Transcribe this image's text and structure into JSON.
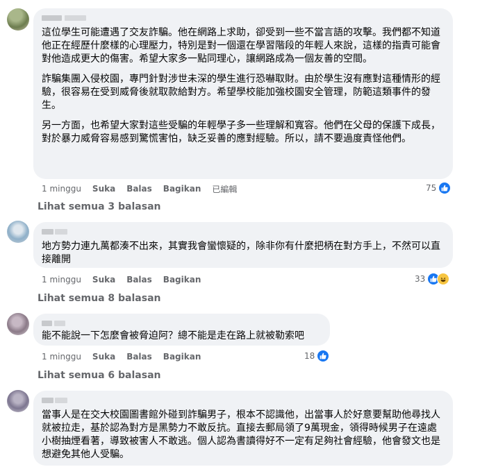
{
  "comments": [
    {
      "paragraphs": [
        "這位學生可能遭遇了交友詐騙。他在網路上求助，卻受到一些不當言語的攻擊。我們都不知道他正在經歷什麼樣的心理壓力，特別是對一個還在學習階段的年輕人來說，這樣的指責可能會對他造成更大的傷害。希望大家多一點同理心，讓網路成為一個友善的空間。",
        "詐騙集團入侵校園，專門針對涉世未深的學生進行恐嚇取財。由於學生沒有應對這種情形的經驗，很容易在受到威脅後就取款給對方。希望學校能加強校園安全管理，防範這類事件的發生。",
        "另一方面，也希望大家對這些受騙的年輕學子多一些理解和寬容。他們在父母的保護下成長，對於暴力威脅容易感到驚慌害怕，缺乏妥善的應對經驗。所以，請不要過度責怪他們。"
      ],
      "time": "1 minggu",
      "like": "Suka",
      "reply": "Balas",
      "share": "Bagikan",
      "edited": "已編輯",
      "reactions": "75",
      "see_replies": "Lihat semua 3 balasan"
    },
    {
      "paragraphs": [
        "地方勢力連九萬都湊不出來，其實我會蠻懷疑的，除非你有什麼把柄在對方手上，不然可以直接離開"
      ],
      "time": "1 minggu",
      "like": "Suka",
      "reply": "Balas",
      "share": "Bagikan",
      "reactions": "33",
      "see_replies": "Lihat semua 8 balasan"
    },
    {
      "paragraphs": [
        "能不能說一下怎麼會被脅迫阿？總不能是走在路上就被勒索吧"
      ],
      "time": "1 minggu",
      "like": "Suka",
      "reply": "Balas",
      "share": "Bagikan",
      "reactions": "18",
      "see_replies": "Lihat semua 6 balasan"
    },
    {
      "paragraphs": [
        "當事人是在交大校園圖書館外碰到詐騙男子，根本不認識他，出當事人於好意要幫助他尋找人就被拉走，基於認為對方是黑勢力不敢反抗。直接去郵局領了9萬現金，領得時候男子在遠處小樹抽煙看著，導致被害人不敢逃。個人認為書讀得好不一定有足夠社會經驗，他會發文也是想避免其他人受騙。"
      ]
    }
  ],
  "colors": {
    "bubble": "#f0f2f5",
    "meta": "#65676b",
    "like_blue": "#1877f2",
    "haha_yellow": "#f7c541"
  },
  "icons": {
    "like": "like-reaction-icon",
    "haha": "haha-reaction-icon"
  }
}
